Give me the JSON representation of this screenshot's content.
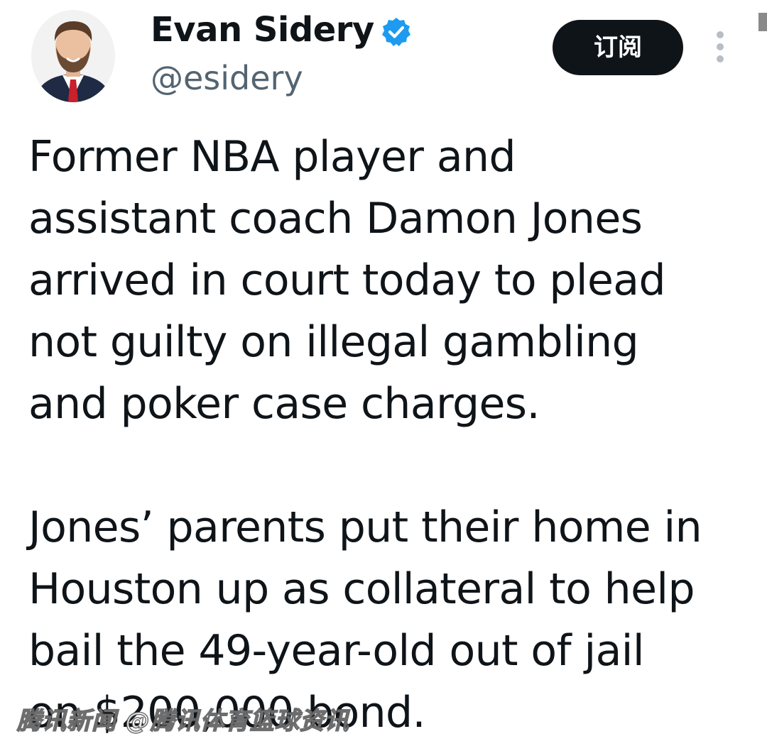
{
  "author": {
    "display_name": "Evan Sidery",
    "handle": "@esidery",
    "verified": true
  },
  "actions": {
    "subscribe_label": "订阅",
    "more_icon": "more-vertical-icon"
  },
  "tweet": {
    "paragraph_1": [
      "Former NBA player and",
      "assistant coach Damon Jones",
      "arrived in court today to plead",
      "not guilty on illegal gambling",
      "and poker case charges."
    ],
    "paragraph_2": [
      "Jones’ parents put their home in",
      "Houston up as collateral to help",
      "bail the 49-year-old out of jail",
      "on $200,000 bond."
    ]
  },
  "watermark": {
    "text": "腾讯新闻 @腾讯体育篮球资讯"
  },
  "colors": {
    "text_primary": "#0f1419",
    "text_secondary": "#536471",
    "verified_blue": "#1d9bf0",
    "button_bg": "#0f1419",
    "button_text": "#ffffff"
  }
}
